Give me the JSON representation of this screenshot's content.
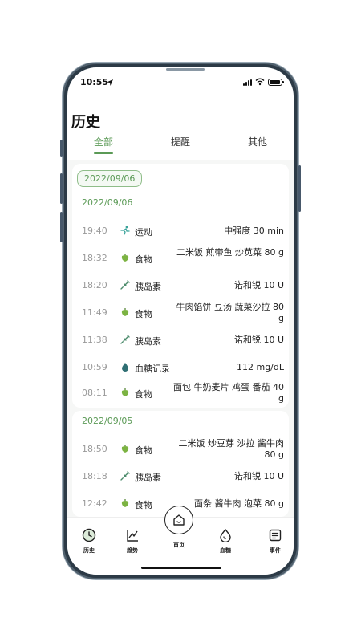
{
  "status": {
    "time": "10:55"
  },
  "header": {
    "title": "历史"
  },
  "tabs": [
    {
      "label": "全部",
      "active": true
    },
    {
      "label": "提醒",
      "active": false
    },
    {
      "label": "其他",
      "active": false
    }
  ],
  "date_chip": "2022/09/06",
  "groups": [
    {
      "date": "2022/09/06",
      "entries": [
        {
          "time": "19:40",
          "icon": "running-icon",
          "category": "运动",
          "value": "中强度 30 min"
        },
        {
          "time": "18:32",
          "icon": "pepper-icon",
          "category": "食物",
          "value": "二米饭 煎带鱼 炒苋菜 80 g"
        },
        {
          "time": "18:20",
          "icon": "syringe-icon",
          "category": "胰岛素",
          "value": "诺和锐 10 U"
        },
        {
          "time": "11:49",
          "icon": "pepper-icon",
          "category": "食物",
          "value": "牛肉馅饼 豆汤 蔬菜沙拉 80 g"
        },
        {
          "time": "11:38",
          "icon": "syringe-icon",
          "category": "胰岛素",
          "value": "诺和锐 10 U"
        },
        {
          "time": "10:59",
          "icon": "blood-drop-icon",
          "category": "血糖记录",
          "value": "112 mg/dL"
        },
        {
          "time": "08:11",
          "icon": "pepper-icon",
          "category": "食物",
          "value": "面包 牛奶麦片 鸡蛋 番茄 40 g"
        }
      ]
    },
    {
      "date": "2022/09/05",
      "entries": [
        {
          "time": "18:50",
          "icon": "pepper-icon",
          "category": "食物",
          "value": "二米饭 炒豆芽 沙拉 酱牛肉 80 g"
        },
        {
          "time": "18:18",
          "icon": "syringe-icon",
          "category": "胰岛素",
          "value": "诺和锐 10 U"
        },
        {
          "time": "12:42",
          "icon": "pepper-icon",
          "category": "食物",
          "value": "面条 酱牛肉 泡菜 80 g"
        }
      ]
    }
  ],
  "nav": {
    "history": "历史",
    "trend": "趋势",
    "home": "首页",
    "glucose": "血糖",
    "events": "事件"
  },
  "colors": {
    "accent": "#5b9a56",
    "frame": "#2c3a46"
  }
}
